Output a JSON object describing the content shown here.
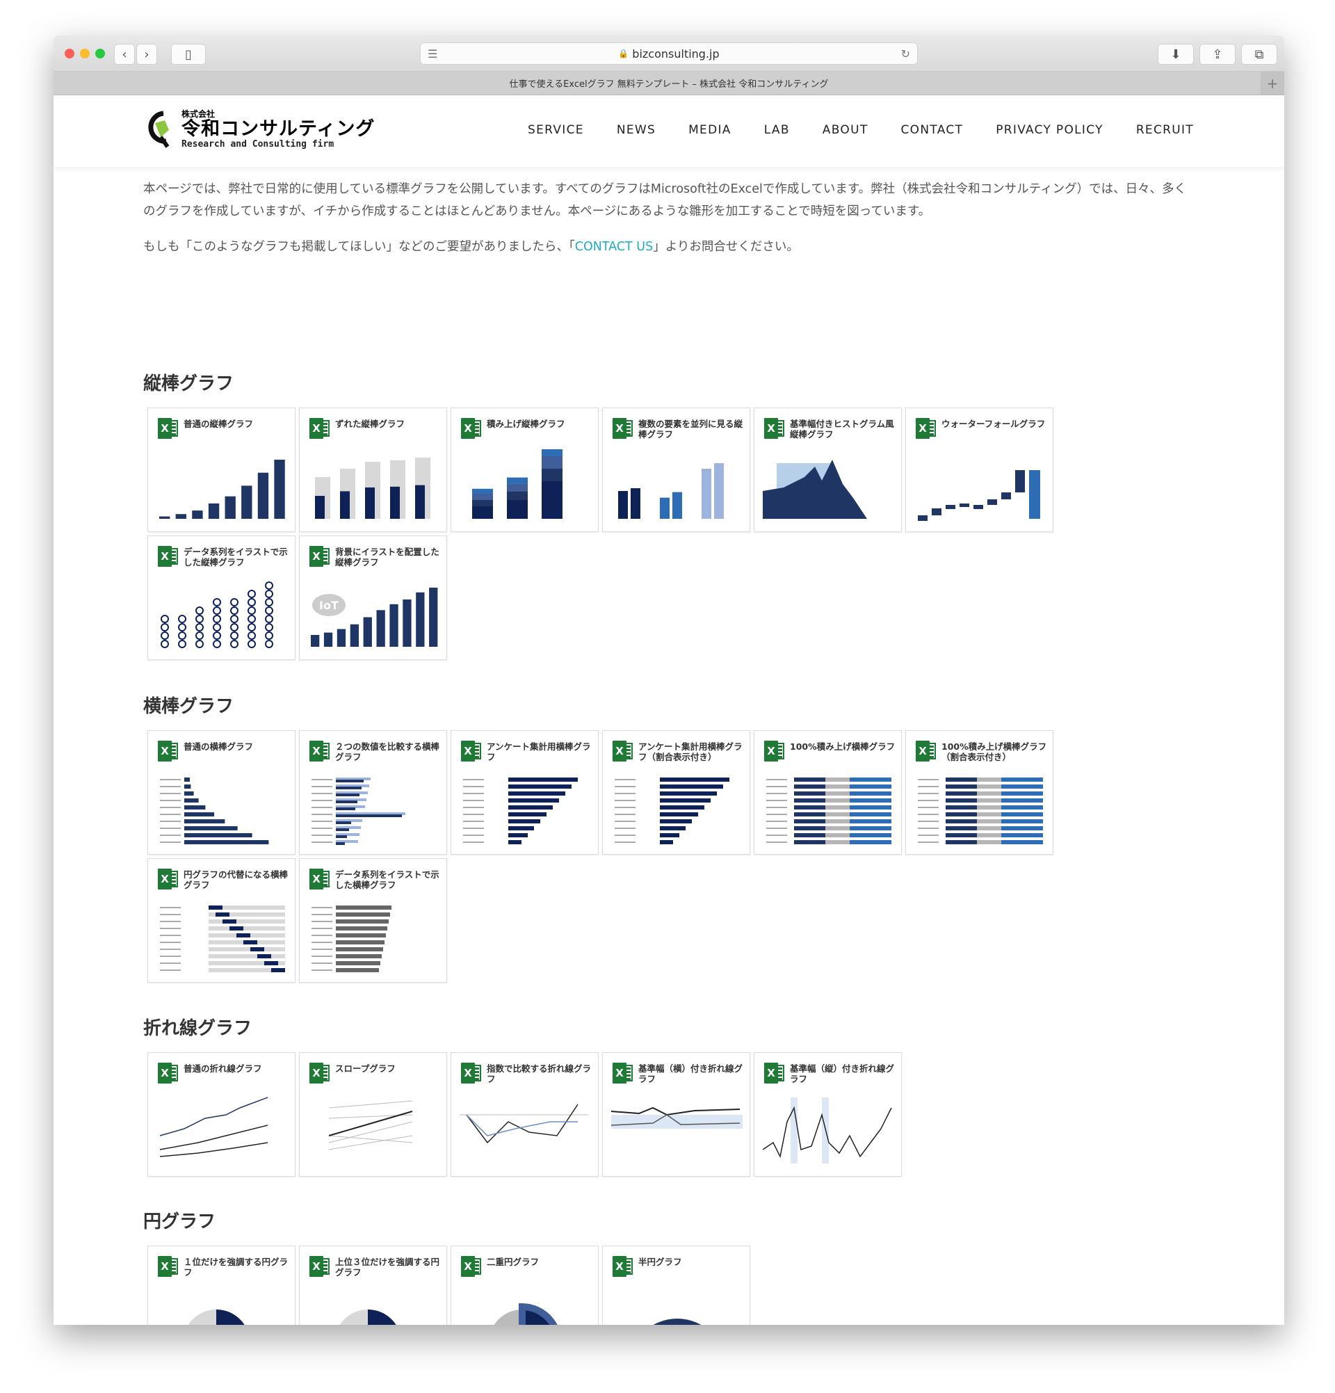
{
  "browser": {
    "url": "bizconsulting.jp",
    "tab_title": "仕事で使えるExcelグラフ 無料テンプレート – 株式会社 令和コンサルティング",
    "icons": [
      "back-icon",
      "forward-icon",
      "sidebar-icon",
      "reader-icon",
      "lock-icon",
      "reload-icon",
      "download-icon",
      "share-icon",
      "tabs-icon",
      "plus-icon"
    ]
  },
  "header": {
    "logo": {
      "small": "株式会社",
      "name": "令和コンサルティング",
      "tagline": "Research and Consulting firm"
    },
    "nav": [
      "SERVICE",
      "NEWS",
      "MEDIA",
      "LAB",
      "ABOUT",
      "CONTACT",
      "PRIVACY POLICY",
      "RECRUIT"
    ]
  },
  "intro": {
    "p1": "本ページでは、弊社で日常的に使用している標準グラフを公開しています。すべてのグラフはMicrosoft社のExcelで作成しています。弊社（株式会社令和コンサルティング）では、日々、多くのグラフを作成していますが、イチから作成することはほとんどありません。本ページにあるような雛形を加工することで時短を図っています。",
    "p2_before": "もしも「このようなグラフも掲載してほしい」などのご要望がありましたら、「",
    "p2_link": "CONTACT US",
    "p2_after": "」よりお問合せください。"
  },
  "colors": {
    "accent": "#1fa9c4",
    "navy": "#1f3563",
    "excel_green": "#1e7a34"
  },
  "sections": [
    {
      "title": "縦棒グラフ",
      "cards": [
        {
          "title": "普通の縦棒グラフ",
          "kind": "vbar"
        },
        {
          "title": "ずれた縦棒グラフ",
          "kind": "vbar-offset"
        },
        {
          "title": "積み上げ縦棒グラフ",
          "kind": "stack"
        },
        {
          "title": "複数の要素を並列に見る縦棒グラフ",
          "kind": "vbar-pairs"
        },
        {
          "title": "基準幅付きヒストグラム風縦棒グラフ",
          "kind": "area"
        },
        {
          "title": "ウォーターフォールグラフ",
          "kind": "waterfall"
        },
        {
          "title": "データ系列をイラストで示した縦棒グラフ",
          "kind": "pictogram"
        },
        {
          "title": "背景にイラストを配置した縦棒グラフ",
          "kind": "vbar-iot"
        }
      ]
    },
    {
      "title": "横棒グラフ",
      "cards": [
        {
          "title": "普通の横棒グラフ",
          "kind": "hbar"
        },
        {
          "title": "２つの数値を比較する横棒グラフ",
          "kind": "hbar-compare"
        },
        {
          "title": "アンケート集計用横棒グラフ",
          "kind": "hbar-desc"
        },
        {
          "title": "アンケート集計用横棒グラフ（割合表示付き）",
          "kind": "hbar-desc"
        },
        {
          "title": "100%積み上げ横棒グラフ",
          "kind": "hstack"
        },
        {
          "title": "100%積み上げ横棒グラフ（割合表示付き）",
          "kind": "hstack"
        },
        {
          "title": "円グラフの代替になる横棒グラフ",
          "kind": "hbar-gantt"
        },
        {
          "title": "データ系列をイラストで示した横棒グラフ",
          "kind": "hbar-picto"
        }
      ]
    },
    {
      "title": "折れ線グラフ",
      "cards": [
        {
          "title": "普通の折れ線グラフ",
          "kind": "line"
        },
        {
          "title": "スロープグラフ",
          "kind": "slope"
        },
        {
          "title": "指数で比較する折れ線グラフ",
          "kind": "line-index"
        },
        {
          "title": "基準幅（横）付き折れ線グラフ",
          "kind": "line-band"
        },
        {
          "title": "基準幅（縦）付き折れ線グラフ",
          "kind": "line-spike"
        }
      ]
    },
    {
      "title": "円グラフ",
      "cards": [
        {
          "title": "１位だけを強調する円グラフ",
          "kind": "pie1"
        },
        {
          "title": "上位３位だけを強調する円グラフ",
          "kind": "pie3"
        },
        {
          "title": "二重円グラフ",
          "kind": "pie2"
        },
        {
          "title": "半円グラフ",
          "kind": "halfpie"
        }
      ]
    }
  ]
}
